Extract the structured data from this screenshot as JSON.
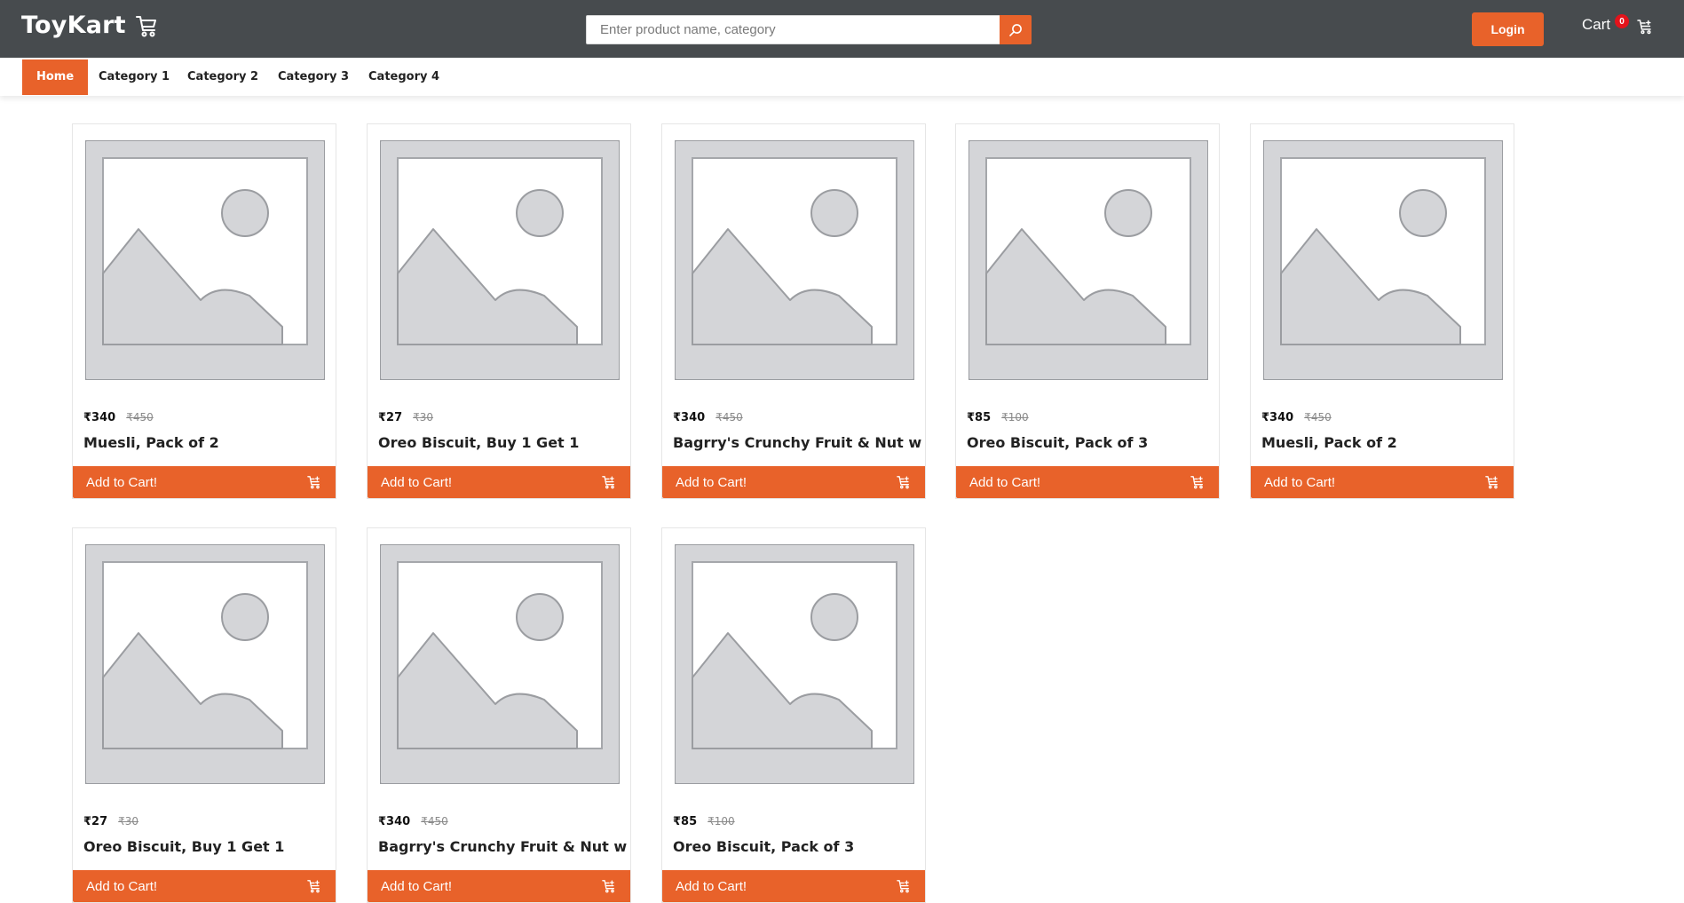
{
  "header": {
    "brand": "ToyKart",
    "search_placeholder": "Enter product name, category",
    "login_label": "Login",
    "cart_label": "Cart",
    "cart_count": "0"
  },
  "nav": {
    "tabs": [
      {
        "label": "Home",
        "active": true
      },
      {
        "label": "Category 1",
        "active": false
      },
      {
        "label": "Category 2",
        "active": false
      },
      {
        "label": "Category 3",
        "active": false
      },
      {
        "label": "Category 4",
        "active": false
      }
    ]
  },
  "products": [
    {
      "price": "₹340",
      "old_price": "₹450",
      "name": "Muesli, Pack of 2",
      "button": "Add to Cart!"
    },
    {
      "price": "₹27",
      "old_price": "₹30",
      "name": "Oreo Biscuit, Buy 1 Get 1",
      "button": "Add to Cart!"
    },
    {
      "price": "₹340",
      "old_price": "₹450",
      "name": "Bagrry's Crunchy Fruit & Nut with Cranberries",
      "button": "Add to Cart!"
    },
    {
      "price": "₹85",
      "old_price": "₹100",
      "name": "Oreo Biscuit, Pack of 3",
      "button": "Add to Cart!"
    },
    {
      "price": "₹340",
      "old_price": "₹450",
      "name": "Muesli, Pack of 2",
      "button": "Add to Cart!"
    },
    {
      "price": "₹27",
      "old_price": "₹30",
      "name": "Oreo Biscuit, Buy 1 Get 1",
      "button": "Add to Cart!"
    },
    {
      "price": "₹340",
      "old_price": "₹450",
      "name": "Bagrry's Crunchy Fruit & Nut with Cranberries",
      "button": "Add to Cart!"
    },
    {
      "price": "₹85",
      "old_price": "₹100",
      "name": "Oreo Biscuit, Pack of 3",
      "button": "Add to Cart!"
    }
  ],
  "colors": {
    "header_bg": "#474b4e",
    "accent": "#e8622a",
    "badge": "#e3131b"
  },
  "icons": {
    "brand": "cart-icon",
    "search": "search-icon",
    "cart": "cart-icon",
    "add": "add-to-cart-icon",
    "product_image": "image-placeholder-icon"
  }
}
